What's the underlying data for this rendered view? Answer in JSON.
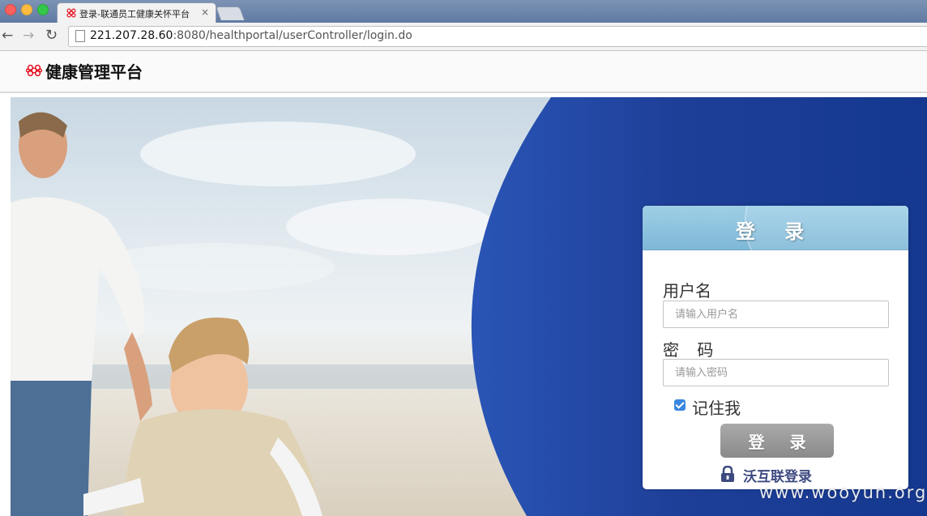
{
  "browser": {
    "tab_title": "登录-联通员工健康关怀平台",
    "tab_close": "×",
    "url_host": "221.207.28.60",
    "url_rest": ":8080/healthportal/userController/login.do",
    "nav": {
      "back": "←",
      "forward": "→",
      "reload": "↻"
    }
  },
  "header": {
    "site_title": "健康管理平台",
    "logo_icon": "china-unicom-knot-icon"
  },
  "login": {
    "heading": "登 录",
    "username_label": "用户名",
    "username_placeholder": "请输入用户名",
    "username_value": "",
    "password_label": "密 码",
    "password_placeholder": "请输入密码",
    "password_value": "",
    "remember_label": "记住我",
    "remember_checked": true,
    "submit_label": "登 录",
    "woo_login_label": "沃互联登录",
    "woo_login_icon": "lock-icon"
  },
  "watermark": "www.wooyun.org",
  "colors": {
    "accent_blue": "#1e3f94",
    "panel_header": "#8cc3df",
    "checkbox": "#3a87e0",
    "button_gray": "#999999",
    "unicom_red": "#e60012"
  }
}
